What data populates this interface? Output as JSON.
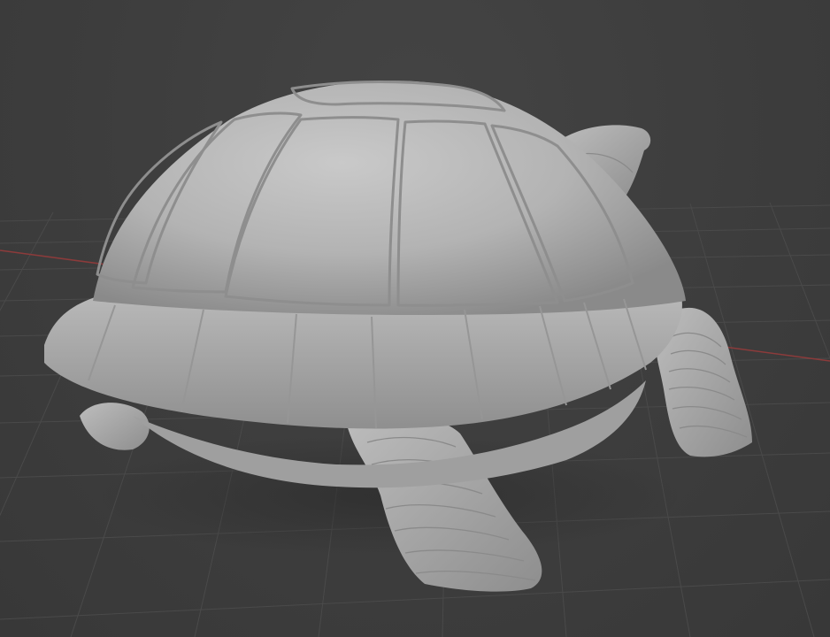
{
  "viewport": {
    "object": "tortoise-sculpt",
    "shading": "solid",
    "background_color": "#3d3d3d",
    "grid_color": "#4a4a4a",
    "x_axis_color": "#8c3b3b",
    "model_color": "#b4b4b4"
  }
}
